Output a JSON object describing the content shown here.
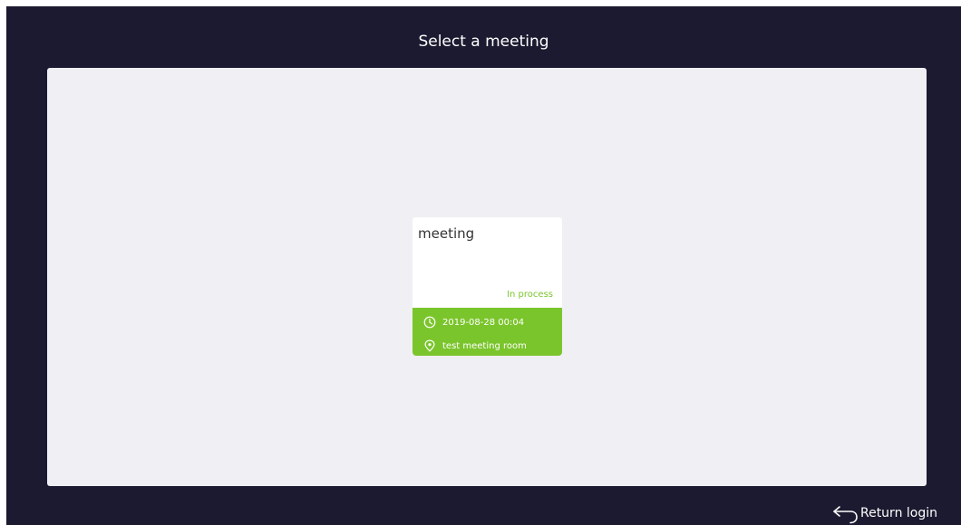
{
  "header": {
    "title": "Select a meeting"
  },
  "meetings": [
    {
      "name": "meeting",
      "status": "In process",
      "datetime": "2019-08-28 00:04",
      "location": "test meeting room",
      "status_color": "#7bc52c",
      "time_icon": "clock-icon",
      "location_icon": "location-pin-icon"
    }
  ],
  "footer": {
    "return_label": "Return login",
    "return_icon": "return-arrow-icon"
  },
  "theme": {
    "background": "#1b1a30",
    "panel": "#efeff4",
    "accent": "#7bc52c"
  }
}
